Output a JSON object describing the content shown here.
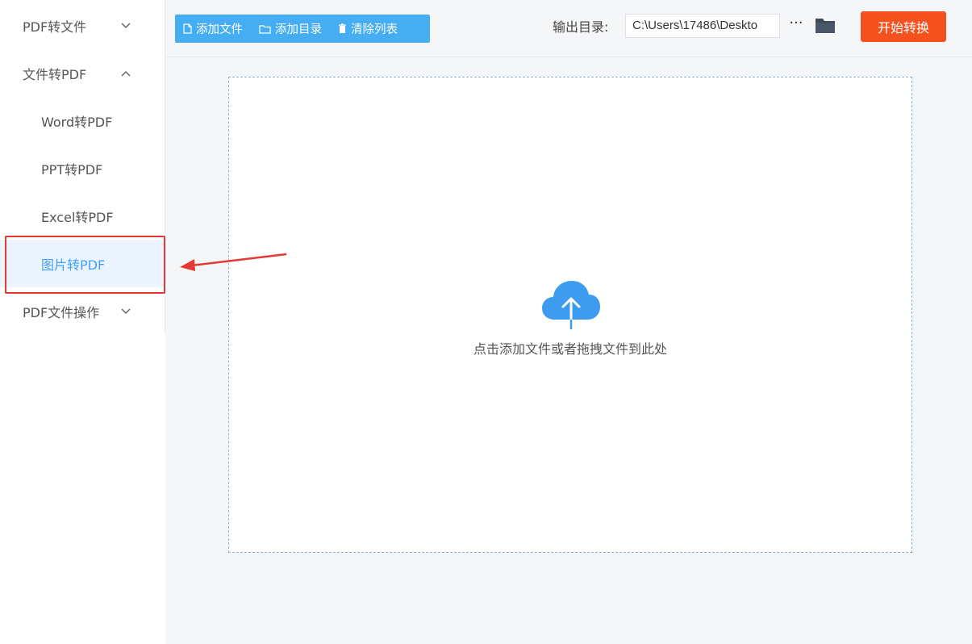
{
  "sidebar": {
    "groups": [
      {
        "label": "PDF转文件",
        "chevron": "chevron-down-icon"
      },
      {
        "label": "文件转PDF",
        "chevron": "chevron-up-icon"
      },
      {
        "label": "PDF文件操作",
        "chevron": "chevron-down-icon"
      }
    ],
    "sub_items": [
      {
        "label": "Word转PDF"
      },
      {
        "label": "PPT转PDF"
      },
      {
        "label": "Excel转PDF"
      },
      {
        "label": "图片转PDF",
        "active": true
      }
    ]
  },
  "toolbar": {
    "add_file_label": "添加文件",
    "add_folder_label": "添加目录",
    "clear_list_label": "清除列表",
    "output_dir_label": "输出目录:",
    "output_dir_value": "C:\\Users\\17486\\Deskto",
    "more_label": "···",
    "start_label": "开始转换"
  },
  "dropzone": {
    "hint": "点击添加文件或者拖拽文件到此处"
  },
  "colors": {
    "accent": "#45aef2",
    "start_button": "#f4511e",
    "highlight": "#e53935",
    "active_item": "#409eff"
  }
}
